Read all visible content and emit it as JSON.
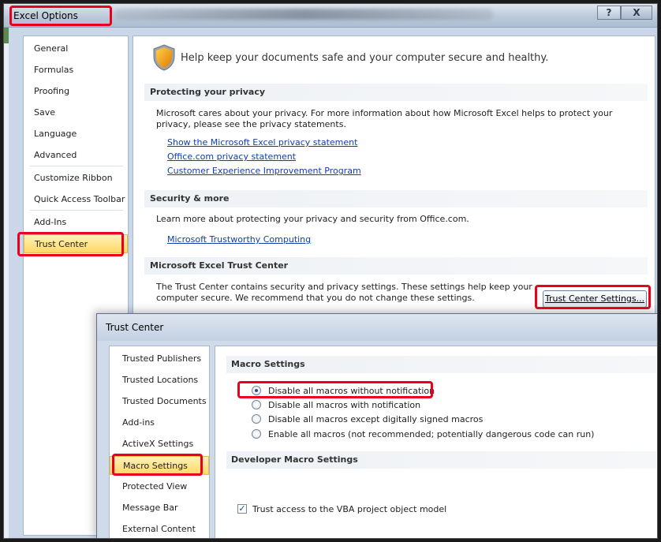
{
  "excel_options": {
    "title": "Excel Options",
    "window_buttons": {
      "help": "?",
      "close": "X"
    },
    "nav": [
      {
        "id": "general",
        "label": "General",
        "selected": false
      },
      {
        "id": "formulas",
        "label": "Formulas",
        "selected": false
      },
      {
        "id": "proofing",
        "label": "Proofing",
        "selected": false
      },
      {
        "id": "save",
        "label": "Save",
        "selected": false
      },
      {
        "id": "language",
        "label": "Language",
        "selected": false
      },
      {
        "id": "advanced",
        "label": "Advanced",
        "selected": false
      },
      {
        "id": "customize-ribbon",
        "label": "Customize Ribbon",
        "selected": false
      },
      {
        "id": "quick-access-toolbar",
        "label": "Quick Access Toolbar",
        "selected": false
      },
      {
        "id": "add-ins",
        "label": "Add-Ins",
        "selected": false
      },
      {
        "id": "trust-center",
        "label": "Trust Center",
        "selected": true
      }
    ],
    "headline": "Help keep your documents safe and your computer secure and healthy.",
    "privacy": {
      "header": "Protecting your privacy",
      "text": "Microsoft cares about your privacy. For more information about how Microsoft Excel helps to protect your privacy, please see the privacy statements.",
      "links": [
        "Show the Microsoft Excel privacy statement",
        "Office.com privacy statement",
        "Customer Experience Improvement Program"
      ]
    },
    "security": {
      "header": "Security & more",
      "text": "Learn more about protecting your privacy and security from Office.com.",
      "link": "Microsoft Trustworthy Computing"
    },
    "trust_center": {
      "header": "Microsoft Excel Trust Center",
      "text_line1": "The Trust Center contains security and privacy settings. These settings help keep your",
      "text_line2": "computer secure. We recommend that you do not change these settings.",
      "button_label": "Trust Center Settings..."
    }
  },
  "trust_center_dialog": {
    "title": "Trust Center",
    "nav": [
      {
        "id": "trusted-publishers",
        "label": "Trusted Publishers",
        "selected": false
      },
      {
        "id": "trusted-locations",
        "label": "Trusted Locations",
        "selected": false
      },
      {
        "id": "trusted-documents",
        "label": "Trusted Documents",
        "selected": false
      },
      {
        "id": "add-ins",
        "label": "Add-ins",
        "selected": false
      },
      {
        "id": "activex-settings",
        "label": "ActiveX Settings",
        "selected": false
      },
      {
        "id": "macro-settings",
        "label": "Macro Settings",
        "selected": true
      },
      {
        "id": "protected-view",
        "label": "Protected View",
        "selected": false
      },
      {
        "id": "message-bar",
        "label": "Message Bar",
        "selected": false
      },
      {
        "id": "external-content",
        "label": "External Content",
        "selected": false
      }
    ],
    "macro_settings": {
      "header": "Macro Settings",
      "options": [
        {
          "label": "Disable all macros without notification",
          "selected": true
        },
        {
          "label": "Disable all macros with notification",
          "selected": false
        },
        {
          "label": "Disable all macros except digitally signed macros",
          "selected": false
        },
        {
          "label": "Enable all macros (not recommended; potentially dangerous code can run)",
          "selected": false
        }
      ]
    },
    "developer_macro_settings": {
      "header": "Developer Macro Settings",
      "trust_vba_label": "Trust access to the VBA project object model",
      "trust_vba_checked": true
    }
  },
  "colors": {
    "highlight_box": "#e8001c",
    "selected_nav": "#ffd966",
    "link": "#0f3fa8"
  },
  "icons": [
    "shield-icon",
    "help-icon",
    "close-icon",
    "radio-selected-icon",
    "checkbox-checked-icon"
  ]
}
